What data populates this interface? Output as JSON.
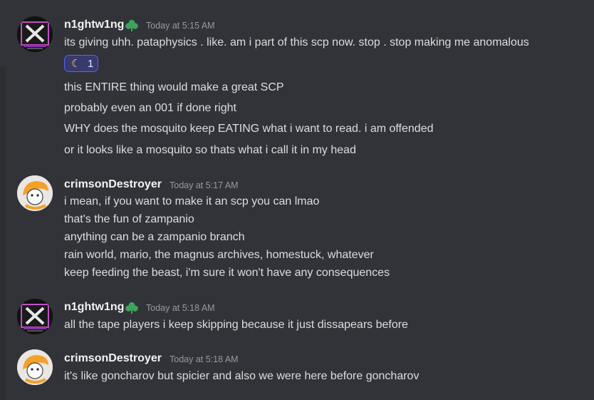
{
  "messages": [
    {
      "author": "n1ghtw1ng",
      "timestamp": "Today at 5:15 AM",
      "lines": [
        "its giving uhh. pataphysics . like. am i part of this scp now. stop . stop making me anomalous"
      ],
      "reaction": {
        "emoji": "☾",
        "count": "1"
      },
      "followups": [
        "this ENTIRE thing would make a great SCP",
        "probably even an 001 if done right",
        "WHY does the mosquito keep EATING what i want to read. i am offended",
        "or it looks like a mosquito so thats what i call it in my head"
      ]
    },
    {
      "author": "crimsonDestroyer",
      "timestamp": "Today at 5:17 AM",
      "lines": [
        "i mean, if you want to make it an scp you can lmao",
        "that's the fun of zampanio",
        "anything can be a zampanio branch",
        "rain world, mario, the magnus archives, homestuck, whatever",
        "keep feeding the beast, i'm sure it won't have any consequences"
      ]
    },
    {
      "author": "n1ghtw1ng",
      "timestamp": "Today at 5:18 AM",
      "lines": [
        "all the tape players i keep skipping because it just dissapears before"
      ]
    },
    {
      "author": "crimsonDestroyer",
      "timestamp": "Today at 5:18 AM",
      "lines": [
        "it's like goncharov but spicier and also we were here before goncharov"
      ]
    }
  ],
  "colors": {
    "background": "#313338",
    "author": "#f2f3f5",
    "text": "#dbdee1",
    "timestamp": "#949ba4",
    "badge": "#3ba55c",
    "reaction_bg": "#373a6c",
    "reaction_border": "#5865f2"
  },
  "icons": {
    "badge": "clover-badge-icon",
    "reaction": "crescent-moon-emoji"
  }
}
